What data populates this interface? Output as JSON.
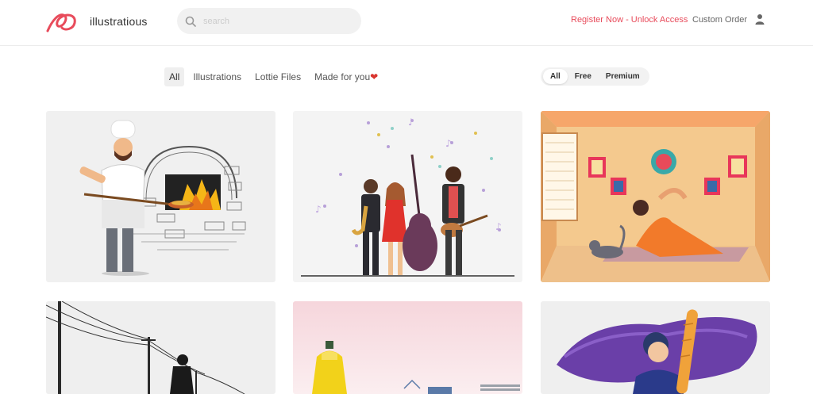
{
  "header": {
    "logo_text": "illustratious",
    "search_placeholder": "search",
    "register_label": "Register Now - Unlock Access",
    "custom_order_label": "Custom Order",
    "accent_color": "#e84b5b"
  },
  "category_tabs": [
    {
      "label": "All",
      "active": true
    },
    {
      "label": "Illustrations",
      "active": false
    },
    {
      "label": "Lottie Files",
      "active": false
    },
    {
      "label": "Made for you",
      "active": false
    }
  ],
  "price_filter": [
    {
      "label": "All",
      "active": true
    },
    {
      "label": "Free",
      "active": false
    },
    {
      "label": "Premium",
      "active": false
    }
  ],
  "icons": {
    "search": "search-icon",
    "user": "user-icon",
    "heart": "heart-icon",
    "logo": "logo-icon"
  },
  "grid": {
    "cards": [
      {
        "subject": "chef-with-pizza-oven"
      },
      {
        "subject": "jazz-band-musicians"
      },
      {
        "subject": "woman-doing-yoga-with-cat"
      },
      {
        "subject": "woman-under-power-lines"
      },
      {
        "subject": "yellow-dress-mannequin"
      },
      {
        "subject": "man-with-baguette"
      }
    ]
  }
}
